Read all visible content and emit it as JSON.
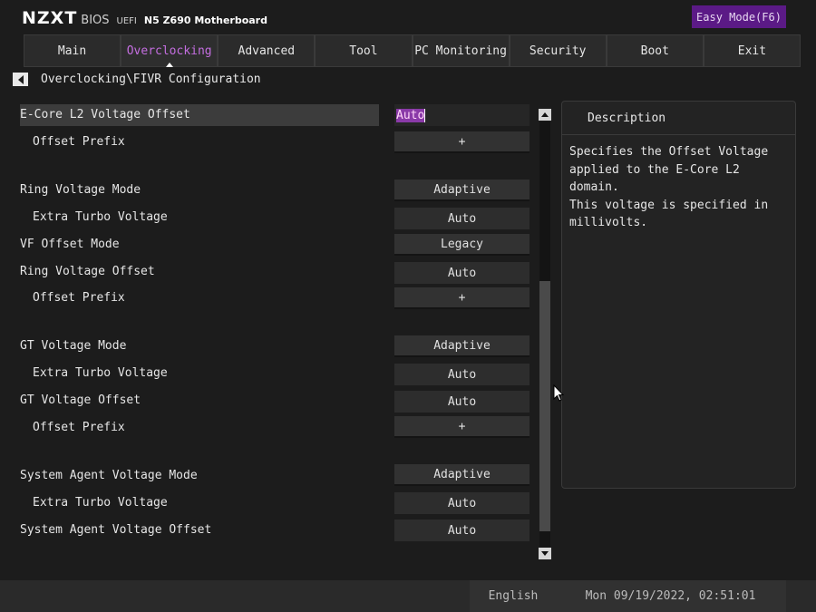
{
  "header": {
    "logo": "NZXT",
    "bios_label": "BIOS",
    "uefi_label": "UEFI",
    "model": "N5 Z690 Motherboard",
    "easy_mode": "Easy Mode(F6)"
  },
  "tabs": [
    {
      "label": "Main"
    },
    {
      "label": "Overclocking",
      "active": true
    },
    {
      "label": "Advanced"
    },
    {
      "label": "Tool"
    },
    {
      "label": "PC Monitoring"
    },
    {
      "label": "Security"
    },
    {
      "label": "Boot"
    },
    {
      "label": "Exit"
    }
  ],
  "breadcrumb": "Overclocking\\FIVR Configuration",
  "settings": [
    {
      "label": "E-Core L2 Voltage Offset",
      "value": "Auto",
      "kind": "input",
      "selected": true
    },
    {
      "label": "Offset Prefix",
      "value": "+",
      "kind": "button"
    },
    {
      "label": "Ring Voltage Mode",
      "value": "Adaptive",
      "kind": "button"
    },
    {
      "label": "Extra Turbo Voltage",
      "value": "Auto",
      "kind": "field"
    },
    {
      "label": "VF Offset Mode",
      "value": "Legacy",
      "kind": "button"
    },
    {
      "label": "Ring Voltage Offset",
      "value": "Auto",
      "kind": "field"
    },
    {
      "label": "Offset Prefix",
      "value": "+",
      "kind": "button"
    },
    {
      "label": "GT Voltage Mode",
      "value": "Adaptive",
      "kind": "button"
    },
    {
      "label": "Extra Turbo Voltage",
      "value": "Auto",
      "kind": "field"
    },
    {
      "label": "GT Voltage Offset",
      "value": "Auto",
      "kind": "field"
    },
    {
      "label": "Offset Prefix",
      "value": "+",
      "kind": "button"
    },
    {
      "label": "System Agent Voltage Mode",
      "value": "Adaptive",
      "kind": "button"
    },
    {
      "label": "Extra Turbo Voltage",
      "value": "Auto",
      "kind": "field"
    },
    {
      "label": "System Agent Voltage Offset",
      "value": "Auto",
      "kind": "field"
    }
  ],
  "description": {
    "title": "Description",
    "text": "Specifies the Offset Voltage\napplied to the E-Core L2 domain.\nThis voltage is specified in\nmillivolts."
  },
  "footer": {
    "language": "English",
    "datetime": "Mon 09/19/2022, 02:51:01"
  },
  "colors": {
    "accent": "#c46ee0",
    "easy_mode_bg": "#5b1a86",
    "background": "#1c1c1c"
  }
}
